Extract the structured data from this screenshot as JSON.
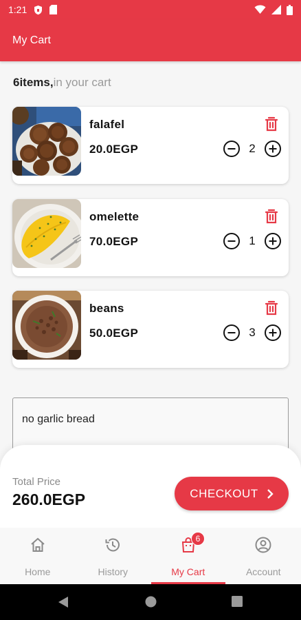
{
  "status_bar": {
    "time": "1:21"
  },
  "app_bar": {
    "title": "My Cart"
  },
  "cart": {
    "count_text": "6items,",
    "subtitle": "in your cart",
    "items": [
      {
        "name": "falafel",
        "price": "20.0EGP",
        "quantity": "2",
        "image": "falafel-photo"
      },
      {
        "name": "omelette",
        "price": "70.0EGP",
        "quantity": "1",
        "image": "omelette-photo"
      },
      {
        "name": "beans",
        "price": "50.0EGP",
        "quantity": "3",
        "image": "beans-photo"
      }
    ]
  },
  "note": {
    "value": "no garlic bread"
  },
  "checkout": {
    "total_label": "Total Price",
    "total_value": "260.0EGP",
    "button_label": "CHECKOUT"
  },
  "nav": {
    "items": [
      {
        "label": "Home",
        "icon": "home-icon"
      },
      {
        "label": "History",
        "icon": "history-icon"
      },
      {
        "label": "My Cart",
        "icon": "shopping-bag-icon",
        "badge": "6"
      },
      {
        "label": "Account",
        "icon": "account-icon"
      }
    ],
    "active": "My Cart"
  },
  "colors": {
    "accent": "#e63946",
    "inactive": "#9a9a9a"
  }
}
